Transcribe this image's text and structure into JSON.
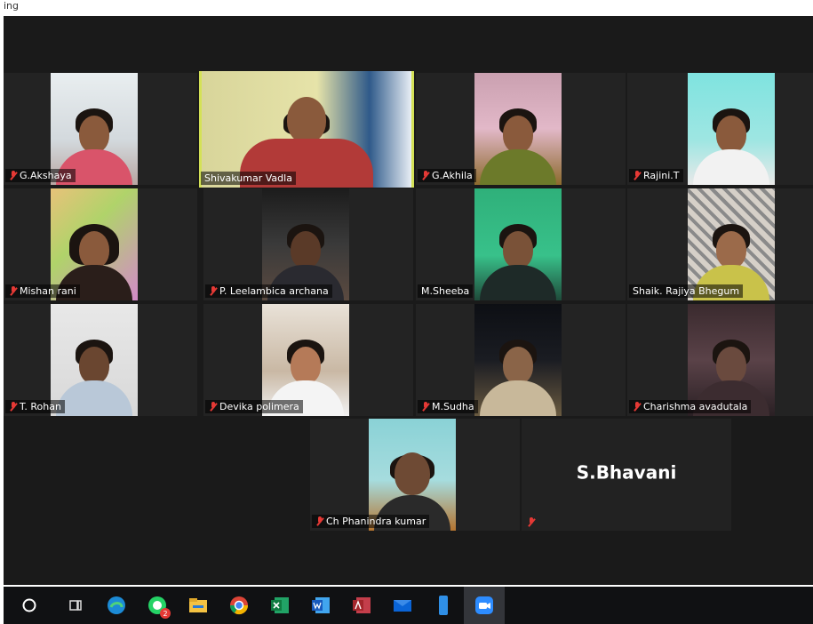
{
  "window": {
    "title": "ing"
  },
  "participants": [
    {
      "name": "G.Akshaya",
      "muted": true
    },
    {
      "name": "Shivakumar Vadla",
      "muted": false,
      "active": true
    },
    {
      "name": "G.Akhila",
      "muted": true
    },
    {
      "name": "Rajini.T",
      "muted": true
    },
    {
      "name": "Mishan rani",
      "muted": true
    },
    {
      "name": "P. Leelambica archana",
      "muted": true
    },
    {
      "name": "M.Sheeba",
      "muted": false
    },
    {
      "name": "Shaik. Rajiya Bhegum",
      "muted": false
    },
    {
      "name": "T. Rohan",
      "muted": true
    },
    {
      "name": "Devika polimera",
      "muted": true
    },
    {
      "name": "M.Sudha",
      "muted": true
    },
    {
      "name": "Charishma avadutala",
      "muted": true
    },
    {
      "name": "Ch Phanindra kumar",
      "muted": true
    },
    {
      "name": "S.Bhavani",
      "muted": true,
      "video_off": true
    }
  ],
  "taskbar": {
    "icons": [
      {
        "name": "search-circle-icon"
      },
      {
        "name": "task-view-icon"
      },
      {
        "name": "edge-icon"
      },
      {
        "name": "whatsapp-icon",
        "badge": "2"
      },
      {
        "name": "file-explorer-icon"
      },
      {
        "name": "chrome-icon"
      },
      {
        "name": "excel-icon"
      },
      {
        "name": "word-icon"
      },
      {
        "name": "access-icon"
      },
      {
        "name": "mail-icon"
      },
      {
        "name": "phone-link-icon"
      },
      {
        "name": "zoom-icon",
        "active": true
      }
    ]
  },
  "colors": {
    "active_speaker": "#d4e157",
    "muted": "#e53935",
    "background": "#1a1a1a"
  }
}
